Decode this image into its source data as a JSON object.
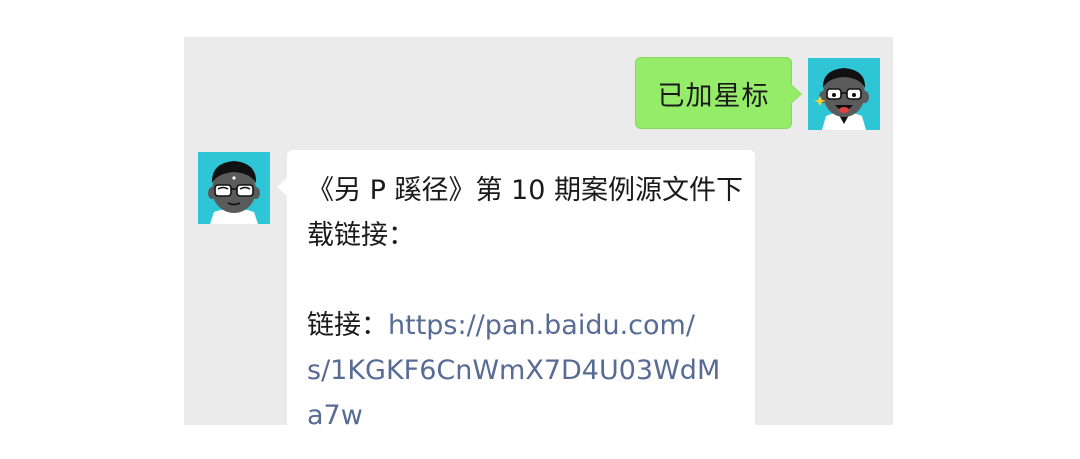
{
  "chat": {
    "messages": [
      {
        "sender": "me",
        "text": "已加星标",
        "bubble_color": "#95ec69"
      },
      {
        "sender": "other",
        "title_line1": "《另 P 蹊径》第 10 期案例源文件下",
        "title_line2": "载链接：",
        "link_label": "链接：",
        "link_line1": "https://pan.baidu.com/",
        "link_line2": "s/1KGKF6CnWmX7D4U03WdM",
        "link_line3": "a7w",
        "bubble_color": "#ffffff",
        "link_color": "#576b95"
      }
    ],
    "background_color": "#ebebeb",
    "avatar_color": "#2ec6d6",
    "icons": {
      "my_avatar": "cartoon-man-glasses-tongue-avatar",
      "other_avatar": "cartoon-man-glasses-avatar"
    }
  }
}
